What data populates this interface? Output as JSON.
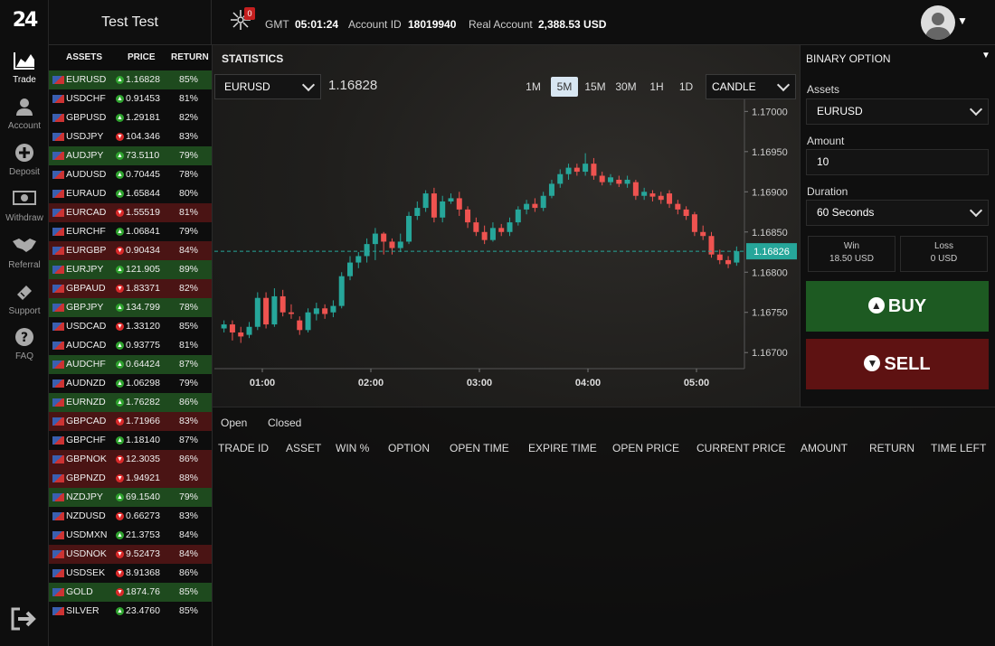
{
  "brand": "24",
  "header": {
    "username": "Test Test",
    "notifications": "0",
    "gmt_label": "GMT",
    "time": "05:01:24",
    "account_id_label": "Account ID",
    "account_id": "18019940",
    "account_type": "Real Account",
    "balance": "2,388.53 USD"
  },
  "nav": [
    {
      "label": "Trade",
      "icon": "chart-icon"
    },
    {
      "label": "Account",
      "icon": "user-icon"
    },
    {
      "label": "Deposit",
      "icon": "plus-icon"
    },
    {
      "label": "Withdraw",
      "icon": "cash-icon"
    },
    {
      "label": "Referral",
      "icon": "handshake-icon"
    },
    {
      "label": "Support",
      "icon": "ticket-icon"
    },
    {
      "label": "FAQ",
      "icon": "question-icon"
    }
  ],
  "assets_table": {
    "headers": [
      "ASSETS",
      "PRICE",
      "RETURN"
    ],
    "rows": [
      {
        "symbol": "EURUSD",
        "price": "1.16828",
        "return": "85%",
        "dir": "up",
        "hl": "green"
      },
      {
        "symbol": "USDCHF",
        "price": "0.91453",
        "return": "81%",
        "dir": "up",
        "hl": ""
      },
      {
        "symbol": "GBPUSD",
        "price": "1.29181",
        "return": "82%",
        "dir": "up",
        "hl": ""
      },
      {
        "symbol": "USDJPY",
        "price": "104.346",
        "return": "83%",
        "dir": "dn",
        "hl": ""
      },
      {
        "symbol": "AUDJPY",
        "price": "73.5110",
        "return": "79%",
        "dir": "up",
        "hl": "green"
      },
      {
        "symbol": "AUDUSD",
        "price": "0.70445",
        "return": "78%",
        "dir": "up",
        "hl": ""
      },
      {
        "symbol": "EURAUD",
        "price": "1.65844",
        "return": "80%",
        "dir": "up",
        "hl": ""
      },
      {
        "symbol": "EURCAD",
        "price": "1.55519",
        "return": "81%",
        "dir": "dn",
        "hl": "red"
      },
      {
        "symbol": "EURCHF",
        "price": "1.06841",
        "return": "79%",
        "dir": "up",
        "hl": ""
      },
      {
        "symbol": "EURGBP",
        "price": "0.90434",
        "return": "84%",
        "dir": "dn",
        "hl": "red"
      },
      {
        "symbol": "EURJPY",
        "price": "121.905",
        "return": "89%",
        "dir": "up",
        "hl": "green"
      },
      {
        "symbol": "GBPAUD",
        "price": "1.83371",
        "return": "82%",
        "dir": "dn",
        "hl": "red"
      },
      {
        "symbol": "GBPJPY",
        "price": "134.799",
        "return": "78%",
        "dir": "up",
        "hl": "green"
      },
      {
        "symbol": "USDCAD",
        "price": "1.33120",
        "return": "85%",
        "dir": "dn",
        "hl": ""
      },
      {
        "symbol": "AUDCAD",
        "price": "0.93775",
        "return": "81%",
        "dir": "up",
        "hl": ""
      },
      {
        "symbol": "AUDCHF",
        "price": "0.64424",
        "return": "87%",
        "dir": "up",
        "hl": "green"
      },
      {
        "symbol": "AUDNZD",
        "price": "1.06298",
        "return": "79%",
        "dir": "up",
        "hl": ""
      },
      {
        "symbol": "EURNZD",
        "price": "1.76282",
        "return": "86%",
        "dir": "up",
        "hl": "green"
      },
      {
        "symbol": "GBPCAD",
        "price": "1.71966",
        "return": "83%",
        "dir": "dn",
        "hl": "red"
      },
      {
        "symbol": "GBPCHF",
        "price": "1.18140",
        "return": "87%",
        "dir": "up",
        "hl": ""
      },
      {
        "symbol": "GBPNOK",
        "price": "12.3035",
        "return": "86%",
        "dir": "dn",
        "hl": "red"
      },
      {
        "symbol": "GBPNZD",
        "price": "1.94921",
        "return": "88%",
        "dir": "dn",
        "hl": "red"
      },
      {
        "symbol": "NZDJPY",
        "price": "69.1540",
        "return": "79%",
        "dir": "up",
        "hl": "green"
      },
      {
        "symbol": "NZDUSD",
        "price": "0.66273",
        "return": "83%",
        "dir": "dn",
        "hl": ""
      },
      {
        "symbol": "USDMXN",
        "price": "21.3753",
        "return": "84%",
        "dir": "up",
        "hl": ""
      },
      {
        "symbol": "USDNOK",
        "price": "9.52473",
        "return": "84%",
        "dir": "dn",
        "hl": "red"
      },
      {
        "symbol": "USDSEK",
        "price": "8.91368",
        "return": "86%",
        "dir": "dn",
        "hl": ""
      },
      {
        "symbol": "GOLD",
        "price": "1874.76",
        "return": "85%",
        "dir": "dn",
        "hl": "green"
      },
      {
        "symbol": "SILVER",
        "price": "23.4760",
        "return": "85%",
        "dir": "up",
        "hl": ""
      }
    ]
  },
  "statistics": {
    "title": "STATISTICS",
    "selected_asset": "EURUSD",
    "current_price": "1.16828",
    "timeframes": [
      "1M",
      "5M",
      "15M",
      "30M",
      "1H",
      "1D"
    ],
    "active_timeframe": "5M",
    "chart_type": "CANDLE",
    "price_marker": "1.16826"
  },
  "chart_data": {
    "type": "candlestick",
    "x_tick_labels": [
      "01:00",
      "02:00",
      "03:00",
      "04:00",
      "05:00"
    ],
    "y_tick_labels": [
      "1.17000",
      "1.16950",
      "1.16900",
      "1.16850",
      "1.16800",
      "1.16750",
      "1.16700"
    ],
    "ylim": [
      1.1668,
      1.17015
    ],
    "current_price": 1.16826,
    "colors": {
      "up": "#26a69a",
      "down": "#ef5350"
    },
    "candles": [
      {
        "o": 1.1673,
        "c": 1.16735,
        "h": 1.1674,
        "l": 1.16725
      },
      {
        "o": 1.16735,
        "c": 1.16725,
        "h": 1.1674,
        "l": 1.16715
      },
      {
        "o": 1.16725,
        "c": 1.1672,
        "h": 1.16732,
        "l": 1.16712
      },
      {
        "o": 1.16722,
        "c": 1.16732,
        "h": 1.16738,
        "l": 1.16718
      },
      {
        "o": 1.16732,
        "c": 1.16768,
        "h": 1.16775,
        "l": 1.16728
      },
      {
        "o": 1.16768,
        "c": 1.16735,
        "h": 1.16775,
        "l": 1.1673
      },
      {
        "o": 1.16735,
        "c": 1.1677,
        "h": 1.1678,
        "l": 1.16732
      },
      {
        "o": 1.1677,
        "c": 1.1675,
        "h": 1.16778,
        "l": 1.16745
      },
      {
        "o": 1.1675,
        "c": 1.16748,
        "h": 1.1676,
        "l": 1.16742
      },
      {
        "o": 1.1674,
        "c": 1.16728,
        "h": 1.16745,
        "l": 1.16722
      },
      {
        "o": 1.16728,
        "c": 1.1675,
        "h": 1.16755,
        "l": 1.16725
      },
      {
        "o": 1.16748,
        "c": 1.16755,
        "h": 1.16762,
        "l": 1.1674
      },
      {
        "o": 1.16755,
        "c": 1.16748,
        "h": 1.1676,
        "l": 1.16742
      },
      {
        "o": 1.1675,
        "c": 1.16758,
        "h": 1.16765,
        "l": 1.16744
      },
      {
        "o": 1.16758,
        "c": 1.16795,
        "h": 1.168,
        "l": 1.16755
      },
      {
        "o": 1.16795,
        "c": 1.16812,
        "h": 1.1682,
        "l": 1.1679
      },
      {
        "o": 1.16812,
        "c": 1.1682,
        "h": 1.16825,
        "l": 1.16805
      },
      {
        "o": 1.1682,
        "c": 1.16835,
        "h": 1.16842,
        "l": 1.16812
      },
      {
        "o": 1.16835,
        "c": 1.16848,
        "h": 1.16855,
        "l": 1.16815
      },
      {
        "o": 1.16848,
        "c": 1.16838,
        "h": 1.1685,
        "l": 1.16822
      },
      {
        "o": 1.16838,
        "c": 1.1683,
        "h": 1.16842,
        "l": 1.16822
      },
      {
        "o": 1.1683,
        "c": 1.16838,
        "h": 1.16848,
        "l": 1.16825
      },
      {
        "o": 1.16838,
        "c": 1.1687,
        "h": 1.16875,
        "l": 1.16835
      },
      {
        "o": 1.1687,
        "c": 1.1688,
        "h": 1.16888,
        "l": 1.16865
      },
      {
        "o": 1.1688,
        "c": 1.16898,
        "h": 1.16902,
        "l": 1.16875
      },
      {
        "o": 1.16898,
        "c": 1.16868,
        "h": 1.16905,
        "l": 1.16862
      },
      {
        "o": 1.16868,
        "c": 1.16888,
        "h": 1.16895,
        "l": 1.16862
      },
      {
        "o": 1.16888,
        "c": 1.16892,
        "h": 1.16898,
        "l": 1.16885
      },
      {
        "o": 1.16892,
        "c": 1.16878,
        "h": 1.169,
        "l": 1.1687
      },
      {
        "o": 1.16878,
        "c": 1.16862,
        "h": 1.16882,
        "l": 1.16855
      },
      {
        "o": 1.16862,
        "c": 1.1685,
        "h": 1.16868,
        "l": 1.16845
      },
      {
        "o": 1.1685,
        "c": 1.1684,
        "h": 1.16858,
        "l": 1.16835
      },
      {
        "o": 1.1684,
        "c": 1.16855,
        "h": 1.16862,
        "l": 1.16838
      },
      {
        "o": 1.16855,
        "c": 1.1685,
        "h": 1.1686,
        "l": 1.16845
      },
      {
        "o": 1.1685,
        "c": 1.16862,
        "h": 1.16868,
        "l": 1.16845
      },
      {
        "o": 1.16862,
        "c": 1.16878,
        "h": 1.16882,
        "l": 1.16858
      },
      {
        "o": 1.16878,
        "c": 1.16885,
        "h": 1.1689,
        "l": 1.16872
      },
      {
        "o": 1.16885,
        "c": 1.1688,
        "h": 1.16892,
        "l": 1.16875
      },
      {
        "o": 1.1688,
        "c": 1.16895,
        "h": 1.169,
        "l": 1.16876
      },
      {
        "o": 1.16895,
        "c": 1.1691,
        "h": 1.16915,
        "l": 1.16892
      },
      {
        "o": 1.1691,
        "c": 1.16922,
        "h": 1.16928,
        "l": 1.16905
      },
      {
        "o": 1.16922,
        "c": 1.1693,
        "h": 1.16935,
        "l": 1.16915
      },
      {
        "o": 1.1693,
        "c": 1.16925,
        "h": 1.16935,
        "l": 1.1692
      },
      {
        "o": 1.16925,
        "c": 1.16935,
        "h": 1.16948,
        "l": 1.1692
      },
      {
        "o": 1.16935,
        "c": 1.1692,
        "h": 1.16942,
        "l": 1.16915
      },
      {
        "o": 1.1692,
        "c": 1.16912,
        "h": 1.16925,
        "l": 1.16908
      },
      {
        "o": 1.16912,
        "c": 1.16918,
        "h": 1.16922,
        "l": 1.16908
      },
      {
        "o": 1.16915,
        "c": 1.1691,
        "h": 1.1692,
        "l": 1.16906
      },
      {
        "o": 1.1691,
        "c": 1.16915,
        "h": 1.1692,
        "l": 1.16905
      },
      {
        "o": 1.16912,
        "c": 1.16895,
        "h": 1.16915,
        "l": 1.1689
      },
      {
        "o": 1.16895,
        "c": 1.169,
        "h": 1.16905,
        "l": 1.1689
      },
      {
        "o": 1.16898,
        "c": 1.16894,
        "h": 1.16902,
        "l": 1.16888
      },
      {
        "o": 1.16895,
        "c": 1.1689,
        "h": 1.169,
        "l": 1.16885
      },
      {
        "o": 1.16898,
        "c": 1.16885,
        "h": 1.16902,
        "l": 1.1688
      },
      {
        "o": 1.16885,
        "c": 1.16878,
        "h": 1.1689,
        "l": 1.16872
      },
      {
        "o": 1.16878,
        "c": 1.1687,
        "h": 1.16882,
        "l": 1.16865
      },
      {
        "o": 1.16872,
        "c": 1.1685,
        "h": 1.16875,
        "l": 1.16845
      },
      {
        "o": 1.1685,
        "c": 1.16845,
        "h": 1.16858,
        "l": 1.1684
      },
      {
        "o": 1.16845,
        "c": 1.16822,
        "h": 1.1685,
        "l": 1.16818
      },
      {
        "o": 1.16822,
        "c": 1.16815,
        "h": 1.16828,
        "l": 1.1681
      },
      {
        "o": 1.16815,
        "c": 1.1681,
        "h": 1.1682,
        "l": 1.16805
      },
      {
        "o": 1.16812,
        "c": 1.16826,
        "h": 1.16832,
        "l": 1.16808
      }
    ]
  },
  "right_panel": {
    "title": "BINARY OPTION",
    "assets_label": "Assets",
    "assets_value": "EURUSD",
    "amount_label": "Amount",
    "amount_value": "10",
    "duration_label": "Duration",
    "duration_value": "60 Seconds",
    "win_label": "Win",
    "win_value": "18.50 USD",
    "loss_label": "Loss",
    "loss_value": "0 USD",
    "buy_label": "BUY",
    "sell_label": "SELL",
    "colors": {
      "buy": "#1d5a22",
      "sell": "#5e1212"
    }
  },
  "trades": {
    "tabs": [
      "Open",
      "Closed"
    ],
    "columns": [
      "TRADE ID",
      "ASSET",
      "WIN %",
      "OPTION",
      "OPEN TIME",
      "EXPIRE TIME",
      "OPEN PRICE",
      "CURRENT PRICE",
      "AMOUNT",
      "RETURN",
      "TIME LEFT"
    ]
  }
}
